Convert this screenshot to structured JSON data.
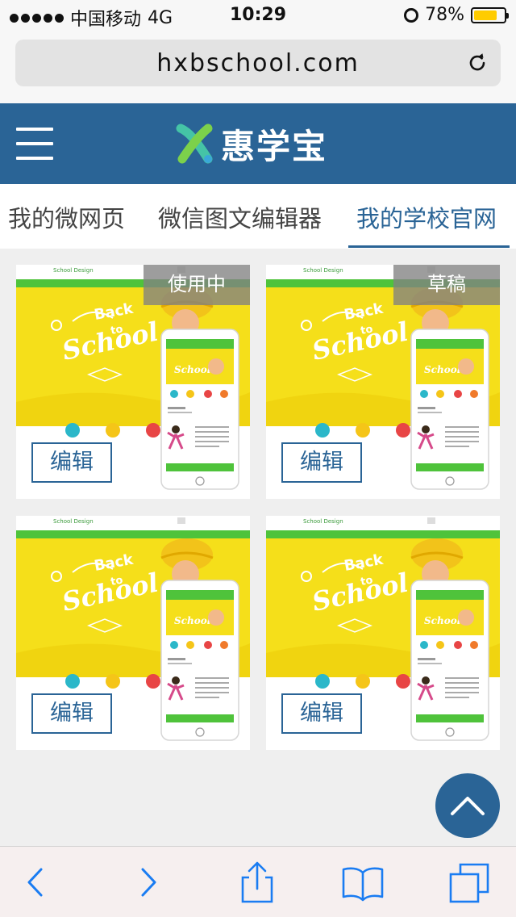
{
  "status_bar": {
    "carrier": "中国移动",
    "network": "4G",
    "time": "10:29",
    "battery": "78%",
    "battery_level": 0.78
  },
  "browser": {
    "url": "hxbschool.com"
  },
  "header": {
    "brand_name": "惠学宝"
  },
  "tabs": [
    {
      "label": "我的微网页"
    },
    {
      "label": "微信图文编辑器"
    },
    {
      "label": "我的学校官网"
    }
  ],
  "cards": [
    {
      "badge": "使用中",
      "edit_label": "编辑"
    },
    {
      "badge": "草稿",
      "edit_label": "编辑"
    },
    {
      "badge": "",
      "edit_label": "编辑"
    },
    {
      "badge": "",
      "edit_label": "编辑"
    }
  ],
  "colors": {
    "primary": "#2a6496",
    "thumb_yellow": "#f5df1a",
    "thumb_green": "#4fc33b"
  }
}
